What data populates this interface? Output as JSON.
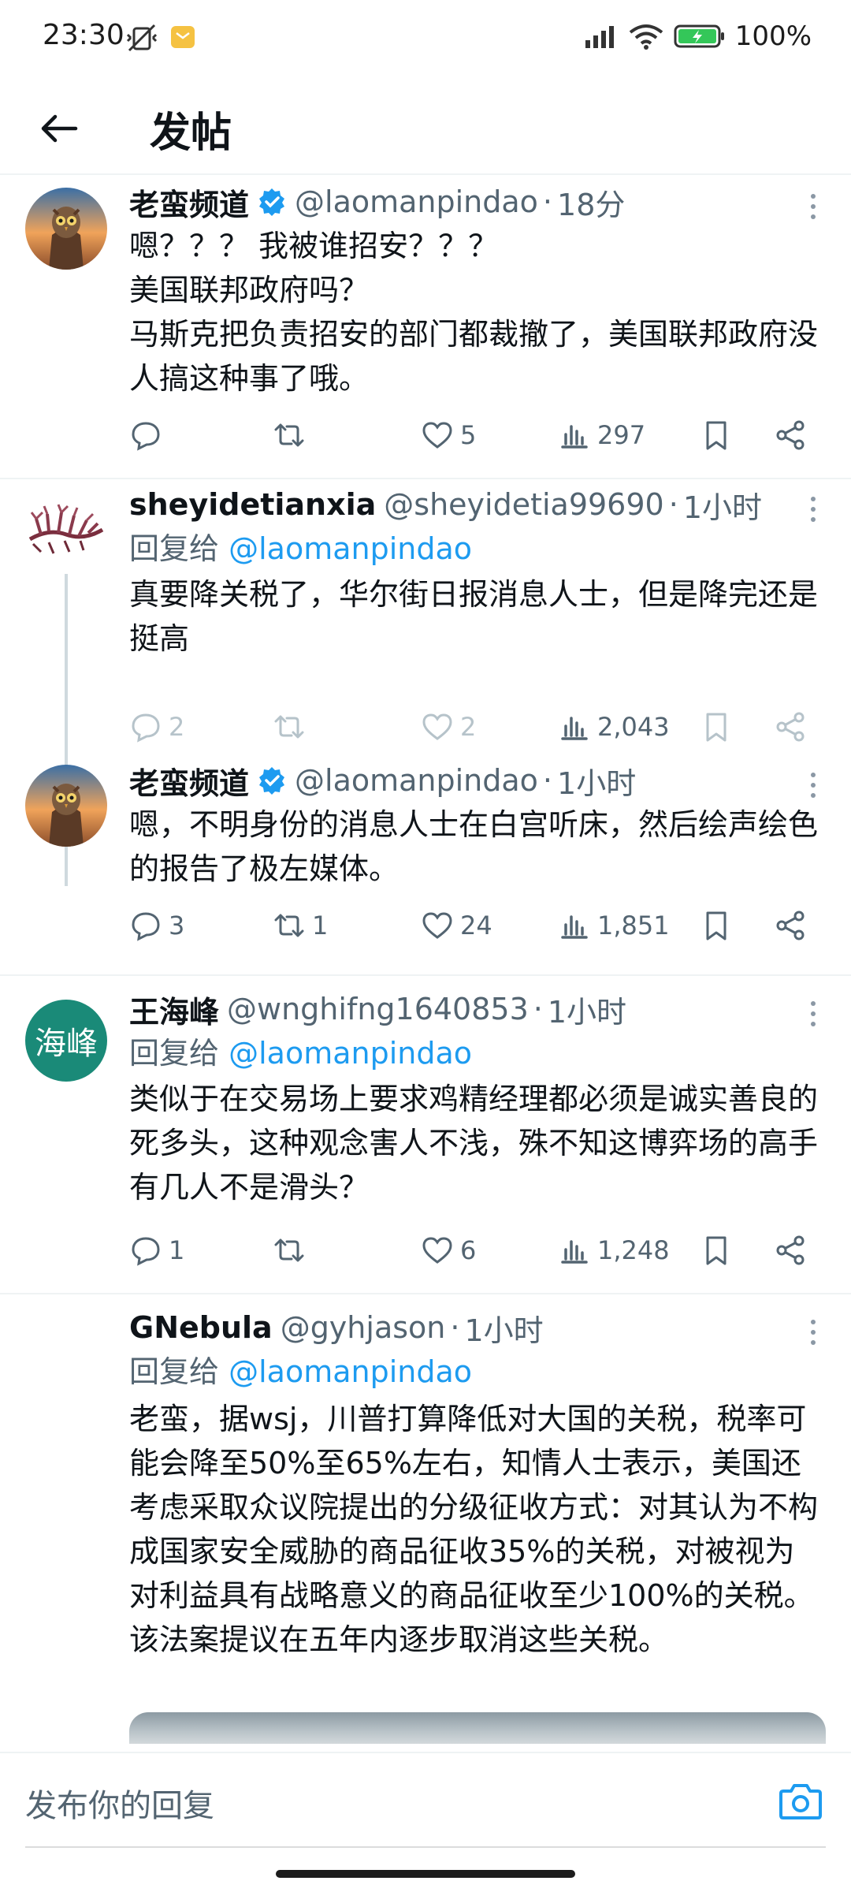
{
  "status_bar": {
    "time": "23:30",
    "battery": "100%"
  },
  "header": {
    "title": "发帖"
  },
  "tweets": [
    {
      "name": "老蛮频道",
      "verified": true,
      "handle": "@laomanpindao",
      "time": "18分",
      "text": "嗯？？？ 我被谁招安？？？\n美国联邦政府吗？\n马斯克把负责招安的部门都裁撤了，美国联邦政府没人搞这种事了哦。",
      "replies": "",
      "retweets": "",
      "likes": "5",
      "views": "297"
    },
    {
      "name": "sheyidetianxia",
      "verified": false,
      "handle": "@sheyidetia99690",
      "time": "1小时",
      "reply_prefix": "回复给",
      "reply_to": "@laomanpindao",
      "text": "真要降关税了，华尔街日报消息人士，但是降完还是挺高",
      "replies": "2",
      "retweets": "",
      "likes": "2",
      "views": "2,043"
    },
    {
      "name": "老蛮频道",
      "verified": true,
      "handle": "@laomanpindao",
      "time": "1小时",
      "text": "嗯，不明身份的消息人士在白宫听床，然后绘声绘色的报告了极左媒体。",
      "replies": "3",
      "retweets": "1",
      "likes": "24",
      "views": "1,851"
    },
    {
      "name": "王海峰",
      "avatar_text": "海峰",
      "verified": false,
      "handle": "@wnghifng1640853",
      "time": "1小时",
      "reply_prefix": "回复给",
      "reply_to": "@laomanpindao",
      "text": "类似于在交易场上要求鸡精经理都必须是诚实善良的死多头，这种观念害人不浅，殊不知这博弈场的高手有几人不是滑头？",
      "replies": "1",
      "retweets": "",
      "likes": "6",
      "views": "1,248"
    },
    {
      "name": "GNebula",
      "verified": false,
      "handle": "@gyhjason",
      "time": "1小时",
      "reply_prefix": "回复给",
      "reply_to": "@laomanpindao",
      "text": "老蛮，据wsj，川普打算降低对大国的关税，税率可能会降至50%至65%左右，知情人士表示，美国还考虑采取众议院提出的分级征收方式：对其认为不构成国家安全威胁的商品征收35%的关税，对被视为对利益具有战略意义的商品征收至少100%的关税。该法案提议在五年内逐步取消这些关税。"
    }
  ],
  "compose": {
    "placeholder": "发布你的回复"
  },
  "colors": {
    "link": "#1d9bf0",
    "secondary_text": "#536471",
    "verified": "#1d9bf0",
    "divider": "#eff3f4"
  },
  "icons": [
    "back-arrow-icon",
    "reply-icon",
    "retweet-icon",
    "like-icon",
    "views-icon",
    "bookmark-icon",
    "share-icon",
    "more-icon",
    "verified-badge-icon",
    "camera-icon"
  ]
}
